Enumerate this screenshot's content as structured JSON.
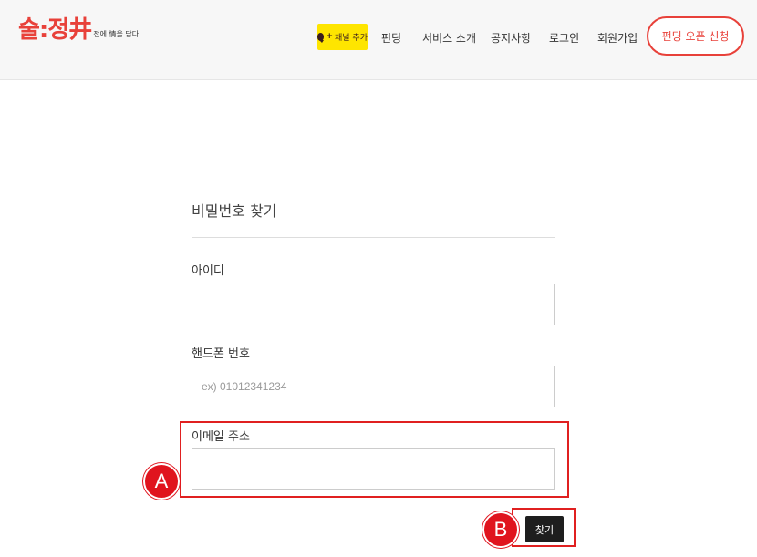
{
  "header": {
    "logo_text": "술:정井",
    "logo_subtext": "전에 情을 담다",
    "kakao_channel_label": "채널 추가",
    "nav_items": [
      "펀딩",
      "서비스 소개",
      "공지사항",
      "로그인",
      "회원가입"
    ],
    "open_funding_label": "펀딩 오픈 신청"
  },
  "form": {
    "title": "비밀번호 찾기",
    "fields": {
      "user_id": {
        "label": "아이디",
        "value": "",
        "placeholder": ""
      },
      "phone": {
        "label": "핸드폰 번호",
        "value": "",
        "placeholder": "ex) 01012341234"
      },
      "email": {
        "label": "이메일 주소",
        "value": "",
        "placeholder": ""
      }
    },
    "submit_label": "찾기"
  },
  "annotations": {
    "marker_a": "A",
    "marker_b": "B",
    "highlight_color": "#e02020"
  },
  "colors": {
    "brand": "#e8413a",
    "kakao": "#fee500",
    "button_dark": "#1e1e1e"
  }
}
